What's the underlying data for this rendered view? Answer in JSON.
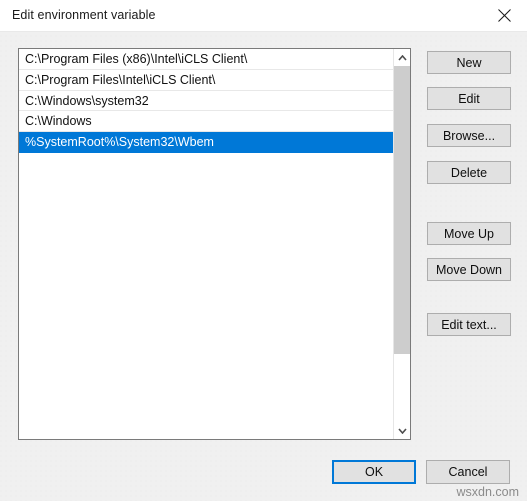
{
  "window": {
    "title": "Edit environment variable",
    "close_icon": "close-icon"
  },
  "colors": {
    "selection_blue": "#0078d7",
    "focus_blue": "#0078d7",
    "dialog_bg": "#f0f0f0",
    "button_bg": "#e1e1e1",
    "button_border": "#adadad",
    "listbox_bg": "#ffffff",
    "scrollbar_thumb": "#cdcdcd",
    "watermark_text": "#8b8b8b"
  },
  "listbox": {
    "name": "environment-variable-paths",
    "selected_index": 4,
    "rows": [
      {
        "text": "C:\\Program Files (x86)\\Intel\\iCLS Client\\",
        "selected": false
      },
      {
        "text": "C:\\Program Files\\Intel\\iCLS Client\\",
        "selected": false
      },
      {
        "text": "C:\\Windows\\system32",
        "selected": false
      },
      {
        "text": "C:\\Windows",
        "selected": false
      },
      {
        "text": "%SystemRoot%\\System32\\Wbem",
        "selected": true
      }
    ],
    "blank_row_count": 13,
    "scrollbar": {
      "up_arrow_icon": "chevron-up-icon",
      "down_arrow_icon": "chevron-down-icon"
    }
  },
  "side_buttons": [
    {
      "id": "new",
      "label": "New"
    },
    {
      "id": "edit",
      "label": "Edit"
    },
    {
      "id": "browse",
      "label": "Browse..."
    },
    {
      "id": "delete",
      "label": "Delete"
    },
    {
      "id": "move-up",
      "label": "Move Up"
    },
    {
      "id": "move-down",
      "label": "Move Down"
    },
    {
      "id": "edit-text",
      "label": "Edit text..."
    }
  ],
  "footer": {
    "ok_label": "OK",
    "cancel_label": "Cancel",
    "default_button": "OK"
  },
  "watermark": {
    "text": "wsxdn.com"
  }
}
